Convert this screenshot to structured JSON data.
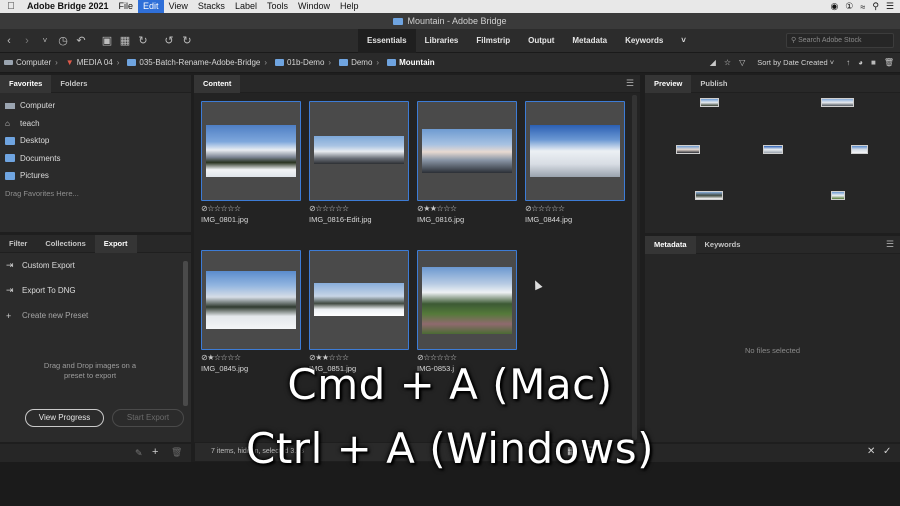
{
  "menubar": {
    "app": "Adobe Bridge 2021",
    "items": [
      "File",
      "Edit",
      "View",
      "Stacks",
      "Label",
      "Tools",
      "Window",
      "Help"
    ],
    "active": "Edit"
  },
  "window": {
    "title": "Mountain - Adobe Bridge"
  },
  "workspaces": [
    "Essentials",
    "Libraries",
    "Filmstrip",
    "Output",
    "Metadata",
    "Keywords"
  ],
  "search": {
    "placeholder": "Search Adobe Stock"
  },
  "path": [
    "Computer",
    "MEDIA 04",
    "035-Batch-Rename-Adobe-Bridge",
    "01b-Demo",
    "Demo",
    "Mountain"
  ],
  "sort": {
    "label": "Sort by Date Created"
  },
  "favorites_panel": {
    "tabs": [
      "Favorites",
      "Folders"
    ],
    "items": [
      {
        "label": "Computer",
        "icon": "computer-icon"
      },
      {
        "label": "teach",
        "icon": "home-icon"
      },
      {
        "label": "Desktop",
        "icon": "folder-icon"
      },
      {
        "label": "Documents",
        "icon": "folder-icon"
      },
      {
        "label": "Pictures",
        "icon": "folder-icon"
      }
    ],
    "hint": "Drag Favorites Here..."
  },
  "export_panel": {
    "tabs": [
      "Filter",
      "Collections",
      "Export"
    ],
    "items": [
      "Custom Export",
      "Export To DNG",
      "Create new Preset"
    ],
    "drop_hint_1": "Drag and Drop images on a",
    "drop_hint_2": "preset to export",
    "view_progress": "View Progress",
    "start_export": "Start Export"
  },
  "content": {
    "tab": "Content",
    "thumbnails": [
      {
        "name": "IMG_0801.jpg",
        "rating": 0
      },
      {
        "name": "IMG_0816-Edit.jpg",
        "rating": 0
      },
      {
        "name": "IMG_0816.jpg",
        "rating": 2
      },
      {
        "name": "IMG_0844.jpg",
        "rating": 0
      },
      {
        "name": "IMG_0845.jpg",
        "rating": 1
      },
      {
        "name": "IMG_0851.jpg",
        "rating": 2
      },
      {
        "name": "IMG-0853.j",
        "rating": 0
      }
    ],
    "status": "7 items, hidden, selected 3.33"
  },
  "preview_panel": {
    "tabs": [
      "Preview",
      "Publish"
    ]
  },
  "metadata_panel": {
    "tabs": [
      "Metadata",
      "Keywords"
    ],
    "empty": "No files selected"
  },
  "overlay": {
    "line1": "Cmd + A (Mac)",
    "line2": "Ctrl + A (Windows)"
  },
  "colors": {
    "selection": "#3d7cd6",
    "folder": "#6fa4e0",
    "menu_active": "#2f6fd8"
  }
}
